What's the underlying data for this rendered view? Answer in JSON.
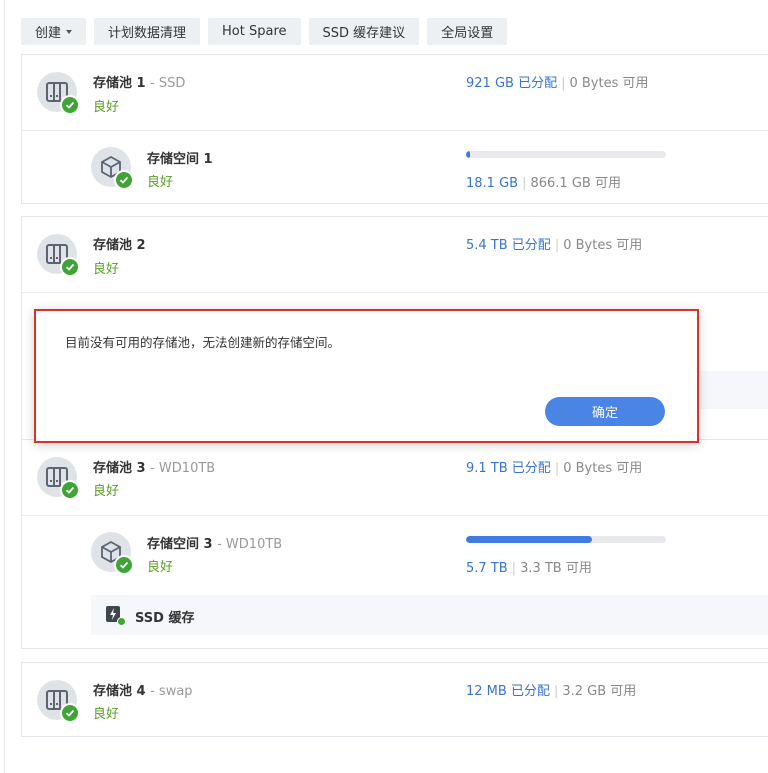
{
  "toolbar": {
    "create": "创建",
    "schedule": "计划数据清理",
    "hotspare": "Hot Spare",
    "ssd_advice": "SSD 缓存建议",
    "global": "全局设置"
  },
  "pools": [
    {
      "name": "存储池 1",
      "sub": "- SSD",
      "status": "良好",
      "allocated": "921 GB 已分配",
      "available": "0 Bytes 可用",
      "volume": {
        "name": "存储空间 1",
        "sub": "",
        "status": "良好",
        "used": "18.1 GB",
        "free": "866.1 GB 可用",
        "fraction": 0.02
      }
    },
    {
      "name": "存储池 2",
      "sub": "",
      "status": "良好",
      "allocated": "5.4 TB 已分配",
      "available": "0 Bytes 可用"
    },
    {
      "name": "存储池 3",
      "sub": "- WD10TB",
      "status": "良好",
      "allocated": "9.1 TB 已分配",
      "available": "0 Bytes 可用",
      "volume": {
        "name": "存储空间 3",
        "sub": "- WD10TB",
        "status": "良好",
        "used": "5.7 TB",
        "free": "3.3 TB 可用",
        "fraction": 0.63
      },
      "cache": "SSD 缓存"
    },
    {
      "name": "存储池 4",
      "sub": "- swap",
      "status": "良好",
      "allocated": "12 MB 已分配",
      "available": "3.2 GB 可用"
    }
  ],
  "dialog": {
    "message": "目前没有可用的存储池，无法创建新的存储空间。",
    "ok": "确定"
  },
  "colors": {
    "accent": "#3f7be0",
    "status_good": "#5a9e28",
    "highlight_border": "#d9322a"
  }
}
